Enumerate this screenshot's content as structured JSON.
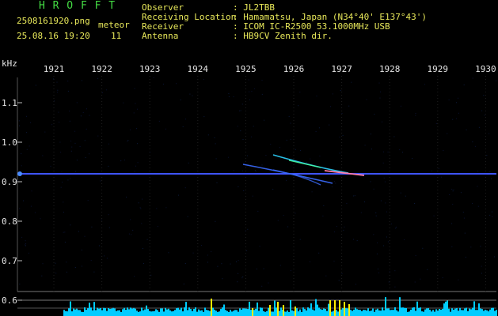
{
  "app": {
    "title": "H R O F F T",
    "filename": "2508161920.png",
    "datetime": "25.08.16 19:20",
    "meteor_label": "meteor",
    "meteor_count": "11"
  },
  "info": {
    "labels": [
      "Observer",
      "Receiving Location",
      "Receiver",
      "Antenna"
    ],
    "values": [
      ": JL2TBB",
      ": Hamamatsu, Japan (N34°40' E137°43')",
      ": ICOM IC-R2500 53.1000MHz USB",
      ": HB9CV Zenith dir."
    ]
  },
  "colors": {
    "title": "#44dd44",
    "info": "#e8e85a",
    "axis": "#e6e6e6",
    "trace": "#3344ff",
    "bottom_bar": "#00ccff",
    "bottom_peak": "#ffee00"
  },
  "chart_data": {
    "type": "heatmap",
    "title": "",
    "y_unit": "kHz",
    "x_ticks": [
      "1921",
      "1922",
      "1923",
      "1924",
      "1925",
      "1926",
      "1927",
      "1928",
      "1929",
      "1930"
    ],
    "y_ticks": [
      "1.1",
      "1.0",
      "0.9",
      "0.8",
      "0.7",
      "0.6"
    ],
    "ylim": [
      0.6,
      1.15
    ],
    "carrier_khz": 0.92
  }
}
